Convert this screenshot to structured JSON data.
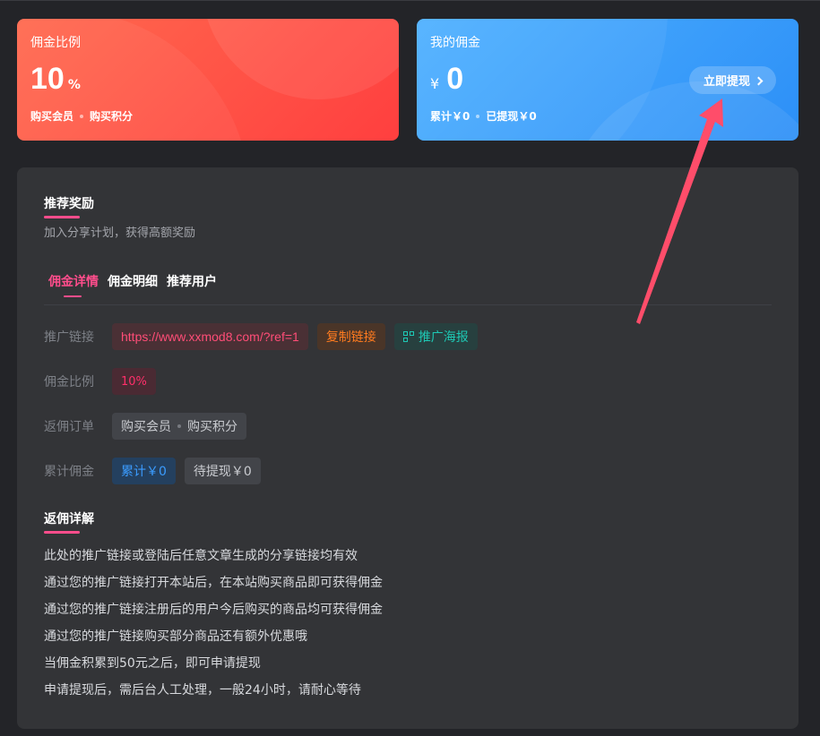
{
  "colors": {
    "accent": "#ff4d8c",
    "red_card": "#ff4a44",
    "blue_card": "#3a9cfb",
    "arrow": "#ff4d6a"
  },
  "ratio_card": {
    "title": "佣金比例",
    "value": "10",
    "unit": "%",
    "items": [
      "购买会员",
      "购买积分"
    ]
  },
  "commission_card": {
    "title": "我的佣金",
    "currency": "¥",
    "value": "0",
    "total": "累计￥0",
    "withdrawn": "已提现￥0",
    "withdraw_button": "立即提现"
  },
  "panel": {
    "title": "推荐奖励",
    "description": "加入分享计划，获得高额奖励",
    "tabs": [
      {
        "label": "佣金详情",
        "active": true
      },
      {
        "label": "佣金明细",
        "active": false
      },
      {
        "label": "推荐用户",
        "active": false
      }
    ],
    "rows": {
      "link_label": "推广链接",
      "link_value": "https://www.xxmod8.com/?ref=1",
      "copy_button": "复制链接",
      "poster_button": "推广海报",
      "rate_label": "佣金比例",
      "rate_value": "10%",
      "order_label": "返佣订单",
      "order_items": [
        "购买会员",
        "购买积分"
      ],
      "total_label": "累计佣金",
      "total_value": "累计￥0",
      "pending_value": "待提现￥0"
    },
    "detail": {
      "title": "返佣详解",
      "items": [
        "此处的推广链接或登陆后任意文章生成的分享链接均有效",
        "通过您的推广链接打开本站后，在本站购买商品即可获得佣金",
        "通过您的推广链接注册后的用户今后购买的商品均可获得佣金",
        "通过您的推广链接购买部分商品还有额外优惠哦",
        "当佣金积累到50元之后，即可申请提现",
        "申请提现后，需后台人工处理，一般24小时，请耐心等待"
      ]
    }
  }
}
